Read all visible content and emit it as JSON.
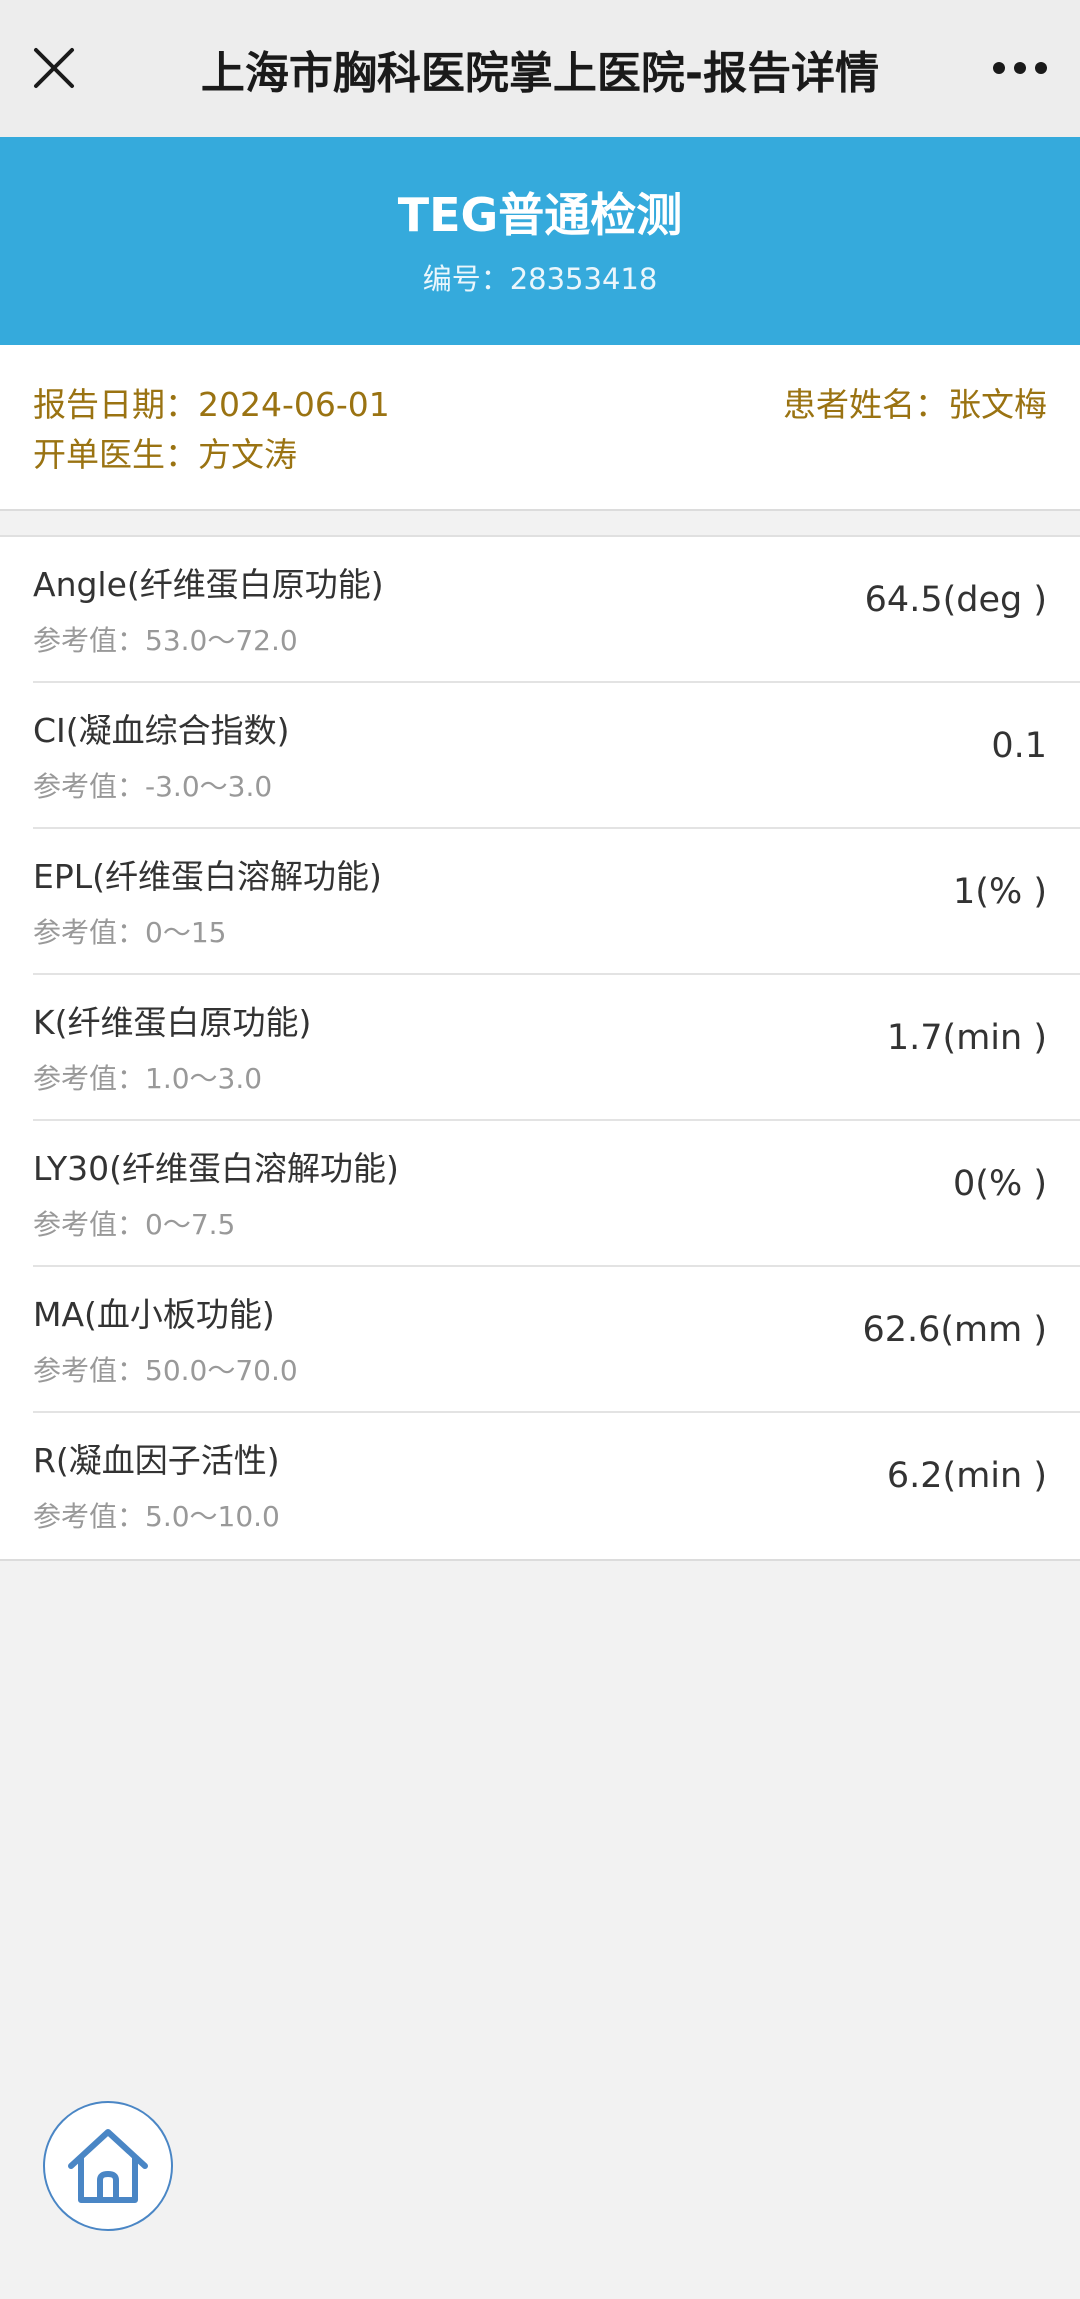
{
  "navbar": {
    "title": "上海市胸科医院掌上医院-报告详情",
    "close_icon": "close-icon",
    "more_icon": "more-icon"
  },
  "report": {
    "title": "TEG普通检测",
    "number": "编号：28353418"
  },
  "info": {
    "report_date": "报告日期：2024-06-01",
    "patient_name": "患者姓名：张文梅",
    "doctor": "开单医生：方文涛"
  },
  "results": [
    {
      "name": "Angle(纤维蛋白原功能)",
      "ref": "参考值：53.0～72.0",
      "value": "64.5(deg )"
    },
    {
      "name": "CI(凝血综合指数)",
      "ref": "参考值：-3.0～3.0",
      "value": "0.1"
    },
    {
      "name": "EPL(纤维蛋白溶解功能)",
      "ref": "参考值：0～15",
      "value": "1(% )"
    },
    {
      "name": "K(纤维蛋白原功能)",
      "ref": "参考值：1.0～3.0",
      "value": "1.7(min )"
    },
    {
      "name": "LY30(纤维蛋白溶解功能)",
      "ref": "参考值：0～7.5",
      "value": "0(% )"
    },
    {
      "name": "MA(血小板功能)",
      "ref": "参考值：50.0～70.0",
      "value": "62.6(mm )"
    },
    {
      "name": "R(凝血因子活性)",
      "ref": "参考值：5.0～10.0",
      "value": "6.2(min )"
    }
  ],
  "home_button": {
    "icon": "home-icon"
  },
  "colors": {
    "header_blue": "#35aadc",
    "info_gold": "#9a7312",
    "home_blue": "#4a86c5"
  }
}
